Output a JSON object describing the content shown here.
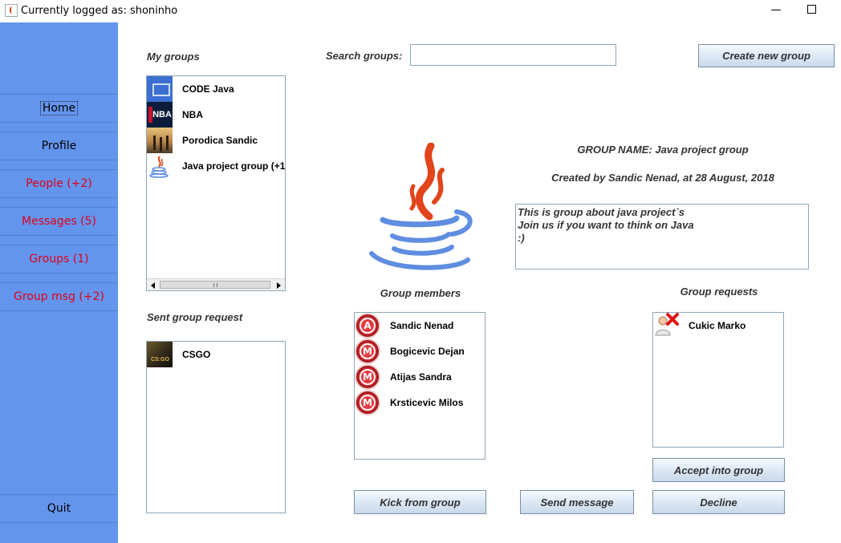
{
  "window": {
    "title": "Currently logged as: shoninho",
    "minimize_icon": "minimize-icon",
    "maximize_icon": "maximize-icon"
  },
  "sidebar": {
    "home": "Home",
    "profile": "Profile",
    "people": "People (+2)",
    "messages": "Messages (5)",
    "groups": "Groups (1)",
    "group_msg": "Group msg (+2)",
    "quit": "Quit",
    "colors": {
      "background": "#6495ed",
      "alert": "#e0001a"
    }
  },
  "my_groups": {
    "label": "My groups",
    "items": [
      {
        "name": "CODE Java",
        "icon": "code-java-icon"
      },
      {
        "name": "NBA",
        "icon": "nba-logo-icon"
      },
      {
        "name": "Porodica Sandic",
        "icon": "family-photo-icon"
      },
      {
        "name": "Java project group (+1",
        "icon": "java-logo-icon"
      }
    ]
  },
  "sent_requests": {
    "label": "Sent group request",
    "items": [
      {
        "name": "CSGO",
        "icon": "csgo-icon"
      }
    ]
  },
  "search": {
    "label": "Search groups:",
    "value": ""
  },
  "create_button": "Create new group",
  "group": {
    "name_line": "GROUP NAME: Java project group",
    "created_line": "Created by Sandic Nenad, at 28 August, 2018",
    "description_lines": [
      "This is group about java project`s",
      "Join us if you want to think on Java",
      ":)"
    ],
    "logo_icon": "java-logo-icon"
  },
  "members": {
    "label": "Group members",
    "items": [
      {
        "name": "Sandic Nenad",
        "badge": "A"
      },
      {
        "name": "Bogicevic Dejan",
        "badge": "M"
      },
      {
        "name": "Atijas Sandra",
        "badge": "M"
      },
      {
        "name": "Krsticevic Milos",
        "badge": "M"
      }
    ]
  },
  "requests": {
    "label": "Group requests",
    "items": [
      {
        "name": "Cukic Marko",
        "icon": "user-reject-icon"
      }
    ]
  },
  "buttons": {
    "accept": "Accept into group",
    "kick": "Kick from group",
    "send_message": "Send message",
    "decline": "Decline"
  }
}
